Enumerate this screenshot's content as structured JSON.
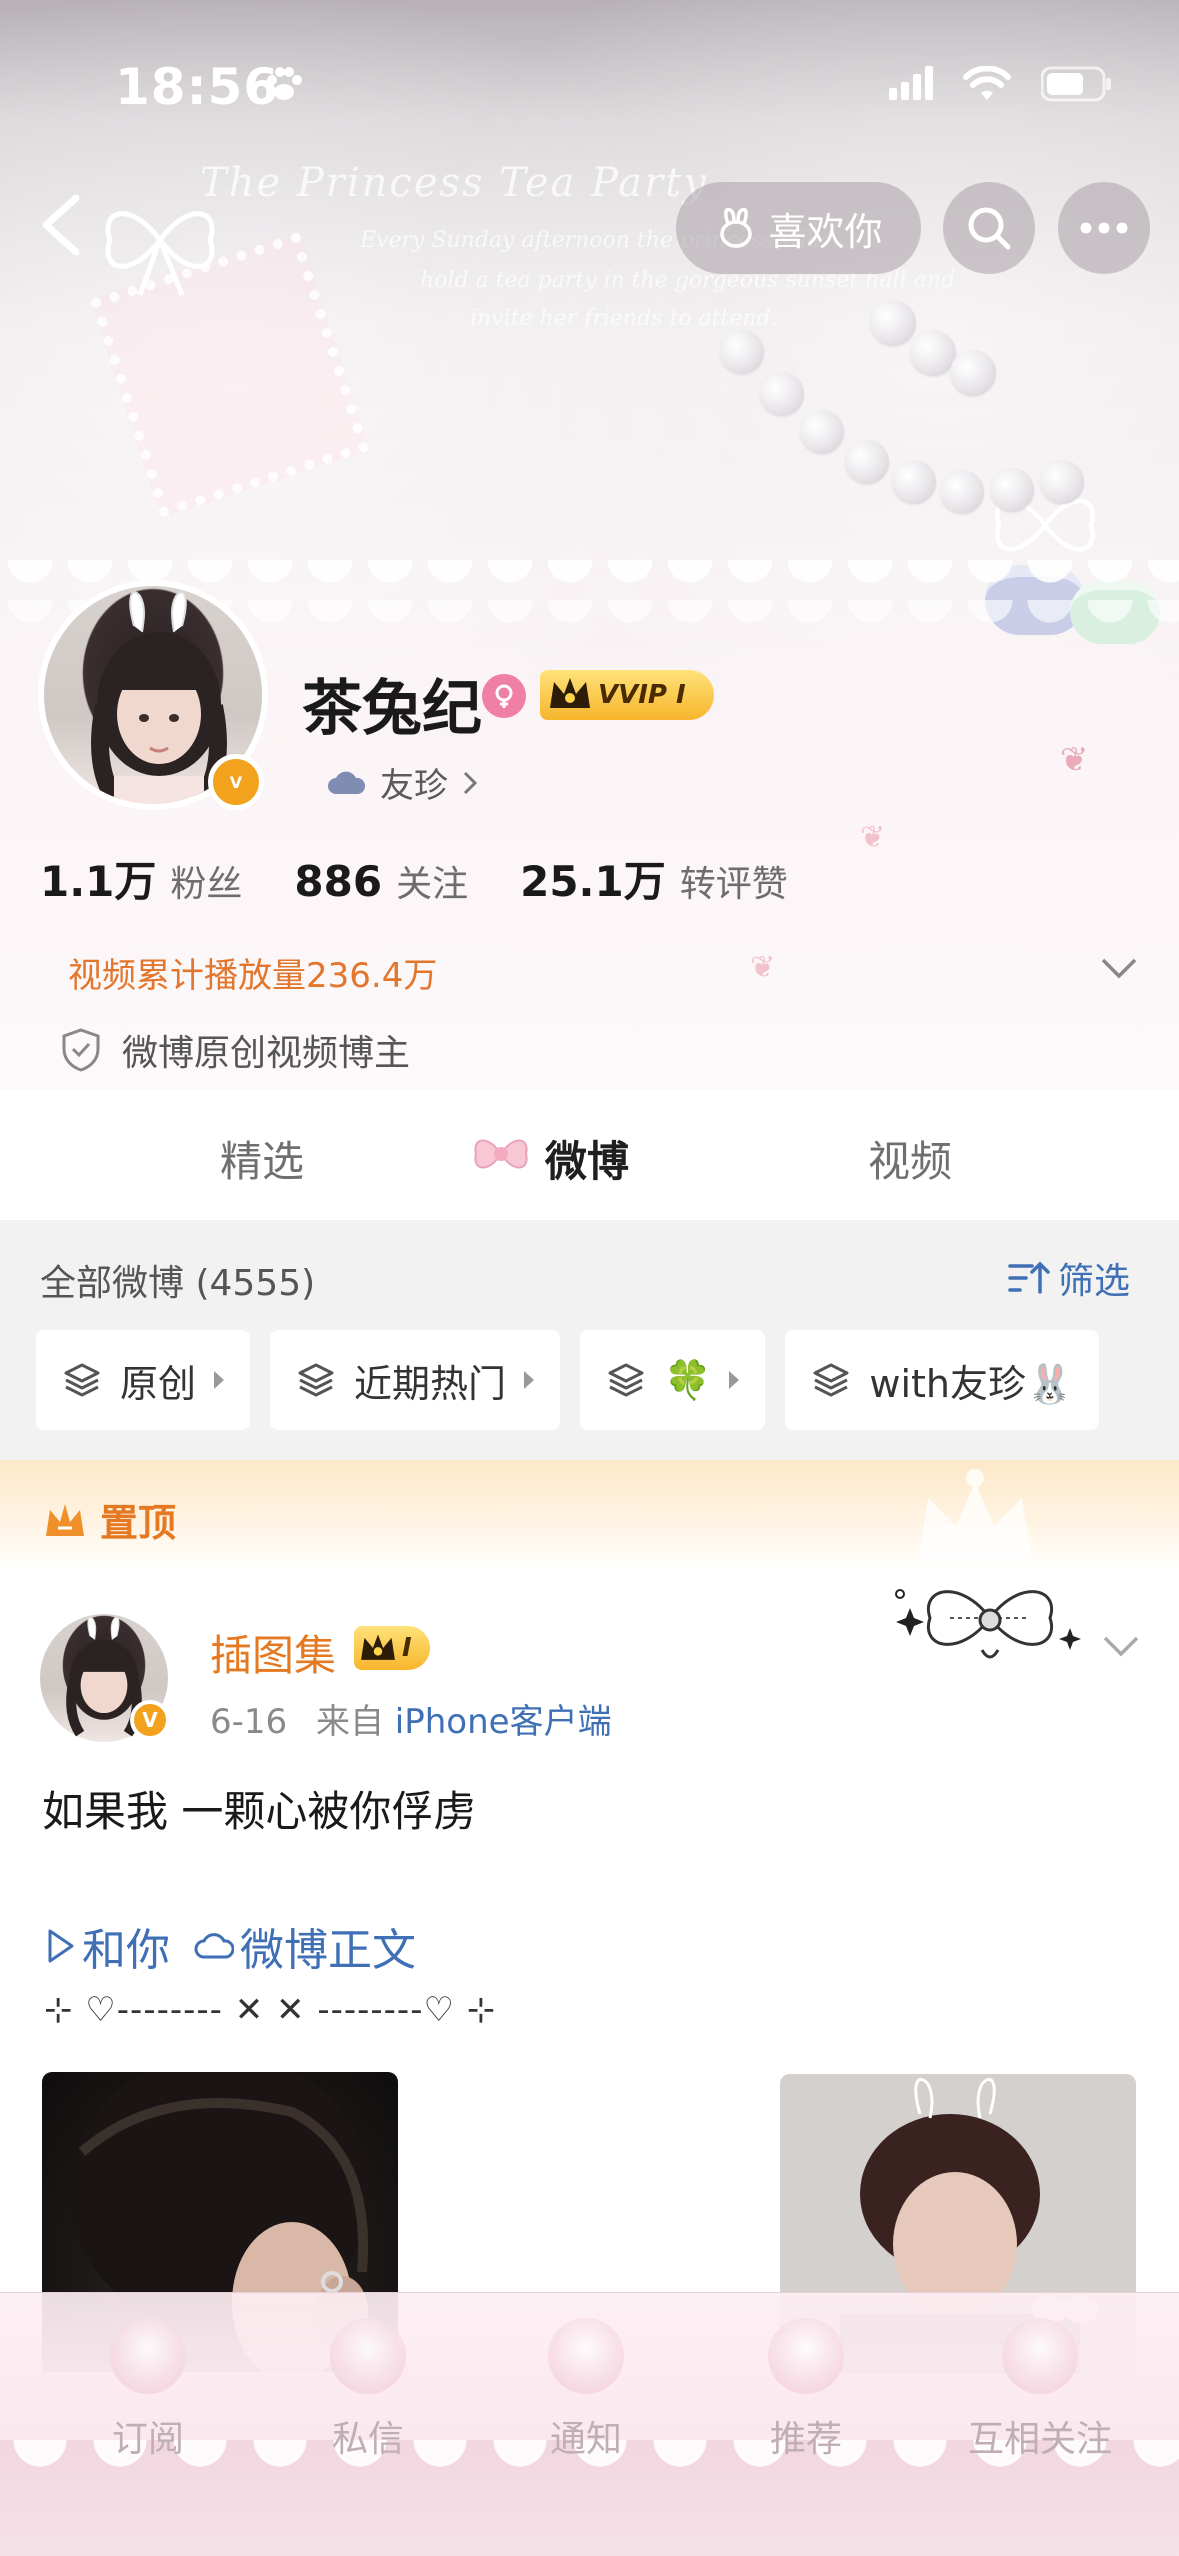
{
  "status_bar": {
    "time": "18:56"
  },
  "header": {
    "like_label": "喜欢你",
    "decor_title": "The Princess Tea Party",
    "decor_lines": [
      "Every Sunday afternoon the princess will",
      "hold a tea party in the gorgeous sunset hall and",
      "invite her friends to attend."
    ]
  },
  "profile": {
    "name": "茶兔纪",
    "vip_label": "VVIP I",
    "verified_label": "V",
    "fan_group": "友珍",
    "stats": [
      {
        "num": "1.1万",
        "label": "粉丝"
      },
      {
        "num": "886",
        "label": "关注"
      },
      {
        "num": "25.1万",
        "label": "转评赞"
      }
    ],
    "video_plays": "视频累计播放量236.4万",
    "creator_tag": "微博原创视频博主"
  },
  "tabs": [
    {
      "label": "精选",
      "active": false
    },
    {
      "label": "微博",
      "active": true
    },
    {
      "label": "视频",
      "active": false
    }
  ],
  "feed": {
    "count_label": "全部微博 (4555)",
    "filter_label": "筛选",
    "chips": [
      {
        "label": "原创"
      },
      {
        "label": "近期热门"
      },
      {
        "label": "🍀"
      },
      {
        "label": "with友珍🐰"
      }
    ]
  },
  "pinned": {
    "label": "置顶",
    "post": {
      "author": "插图集",
      "badge": "I",
      "date": "6-16",
      "source_prefix": "来自",
      "source": "iPhone客户端",
      "text": "如果我 一颗心被你俘虏",
      "link1": "和你",
      "link2": "微博正文",
      "deco_line": "⊹ ♡-------- ✕ ✕ --------♡ ⊹"
    }
  },
  "bottom_nav": [
    {
      "label": "订阅"
    },
    {
      "label": "私信"
    },
    {
      "label": "通知"
    },
    {
      "label": "推荐"
    },
    {
      "label": "互相关注"
    }
  ],
  "colors": {
    "accent_orange": "#e57921",
    "link_blue": "#3f6fb5",
    "vip_gold": "#f7b52c",
    "feed_bg": "#f2f2f2"
  }
}
